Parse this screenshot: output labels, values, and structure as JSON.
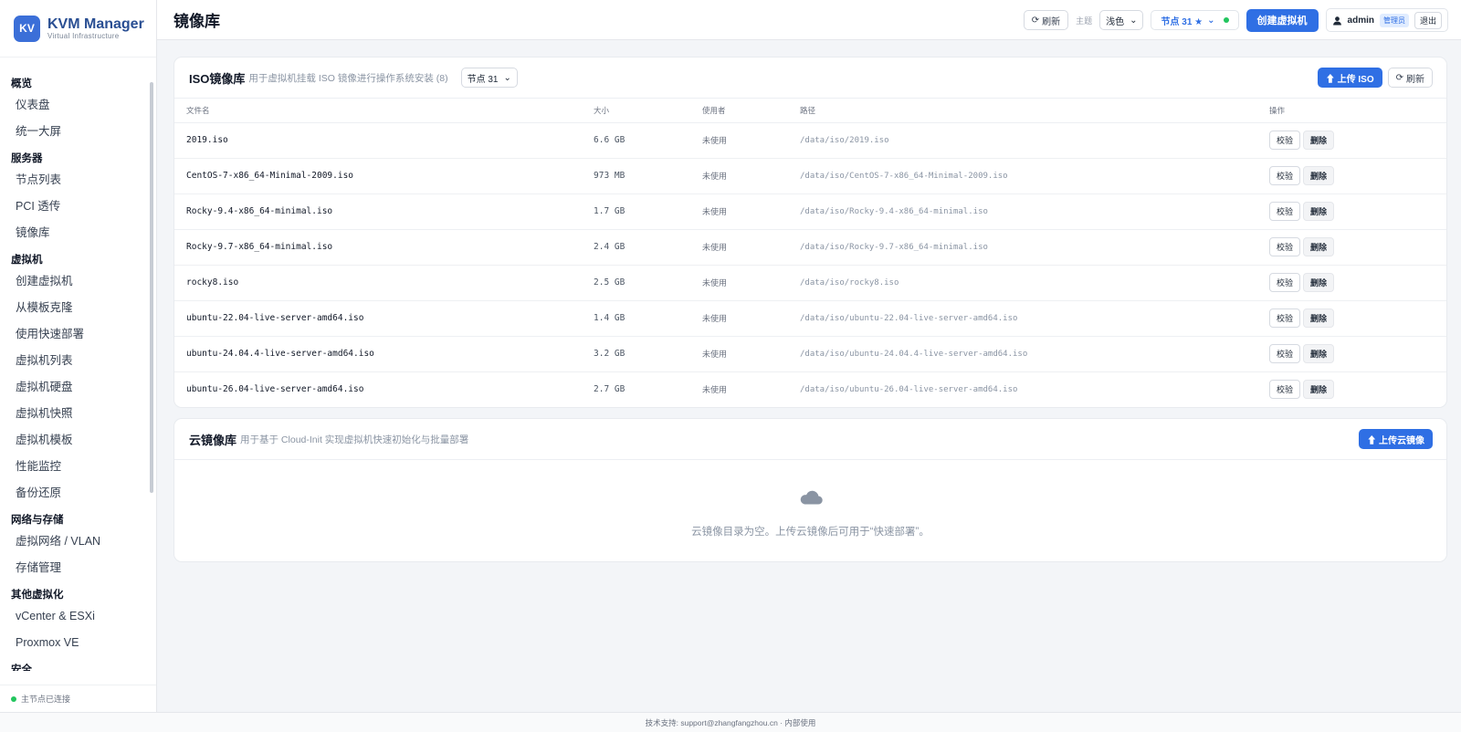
{
  "brand": {
    "logo": "KV",
    "name": "KVM Manager",
    "sub": "Virtual Infrastructure"
  },
  "sidebar": {
    "groups": [
      {
        "title": "概览",
        "items": [
          "仪表盘",
          "统一大屏"
        ]
      },
      {
        "title": "服务器",
        "items": [
          "节点列表",
          "PCI 透传",
          "镜像库"
        ]
      },
      {
        "title": "虚拟机",
        "items": [
          "创建虚拟机",
          "从模板克隆",
          "使用快速部署",
          "虚拟机列表",
          "虚拟机硬盘",
          "虚拟机快照",
          "虚拟机模板",
          "性能监控",
          "备份还原"
        ]
      },
      {
        "title": "网络与存储",
        "items": [
          "虚拟网络 / VLAN",
          "存储管理"
        ]
      },
      {
        "title": "其他虚拟化",
        "items": [
          "vCenter & ESXi",
          "Proxmox VE"
        ]
      },
      {
        "title": "安全",
        "items": []
      }
    ],
    "status": "主节点已连接"
  },
  "header": {
    "title": "镜像库",
    "refresh": "刷新",
    "theme_label": "主题",
    "theme_value": "浅色",
    "node": "节点 31 ★",
    "create_vm": "创建虚拟机",
    "user": "admin",
    "role": "管理员",
    "logout": "退出"
  },
  "iso": {
    "title": "ISO镜像库",
    "desc": "用于虚拟机挂载 ISO 镜像进行操作系统安装 (8)",
    "node_select": "节点 31",
    "upload": "⬆ 上传 ISO",
    "refresh": "刷新",
    "columns": [
      "文件名",
      "大小",
      "使用者",
      "路径",
      "操作"
    ],
    "verify_label": "校验",
    "delete_label": "删除",
    "rows": [
      {
        "name": "2019.iso",
        "size": "6.6 GB",
        "usage": "未使用",
        "path": "/data/iso/2019.iso"
      },
      {
        "name": "CentOS-7-x86_64-Minimal-2009.iso",
        "size": "973 MB",
        "usage": "未使用",
        "path": "/data/iso/CentOS-7-x86_64-Minimal-2009.iso"
      },
      {
        "name": "Rocky-9.4-x86_64-minimal.iso",
        "size": "1.7 GB",
        "usage": "未使用",
        "path": "/data/iso/Rocky-9.4-x86_64-minimal.iso"
      },
      {
        "name": "Rocky-9.7-x86_64-minimal.iso",
        "size": "2.4 GB",
        "usage": "未使用",
        "path": "/data/iso/Rocky-9.7-x86_64-minimal.iso"
      },
      {
        "name": "rocky8.iso",
        "size": "2.5 GB",
        "usage": "未使用",
        "path": "/data/iso/rocky8.iso"
      },
      {
        "name": "ubuntu-22.04-live-server-amd64.iso",
        "size": "1.4 GB",
        "usage": "未使用",
        "path": "/data/iso/ubuntu-22.04-live-server-amd64.iso"
      },
      {
        "name": "ubuntu-24.04.4-live-server-amd64.iso",
        "size": "3.2 GB",
        "usage": "未使用",
        "path": "/data/iso/ubuntu-24.04.4-live-server-amd64.iso"
      },
      {
        "name": "ubuntu-26.04-live-server-amd64.iso",
        "size": "2.7 GB",
        "usage": "未使用",
        "path": "/data/iso/ubuntu-26.04-live-server-amd64.iso"
      }
    ]
  },
  "cloud": {
    "title": "云镜像库",
    "desc": "用于基于 Cloud-Init 实现虚拟机快速初始化与批量部署",
    "upload": "⬆ 上传云镜像",
    "empty": "云镜像目录为空。上传云镜像后可用于“快速部署”。"
  },
  "footer": "技术支持: support@zhangfangzhou.cn · 内部使用",
  "colors": {
    "accent": "#2f6fe4",
    "brand": "#3b6fd8",
    "connected": "#22c55e"
  }
}
